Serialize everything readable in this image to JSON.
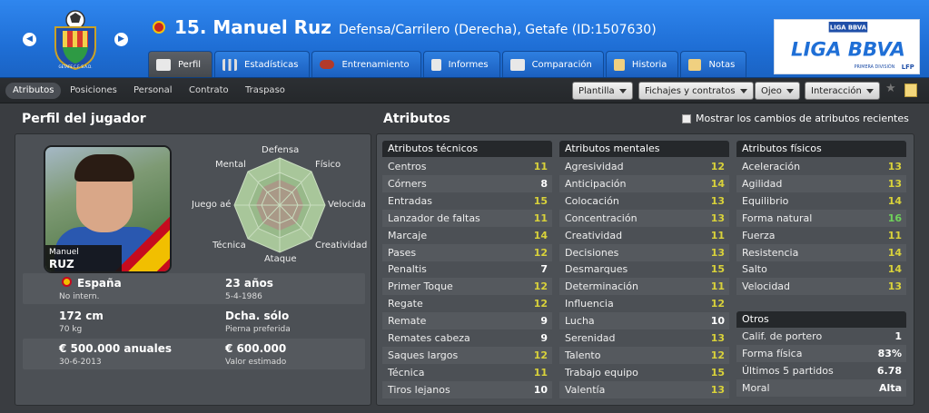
{
  "header": {
    "player_title": "15. Manuel Ruz",
    "subtitle": "Defensa/Carrilero (Derecha), Getafe (ID:1507630)",
    "nav_prev": "◀",
    "nav_next": "▶",
    "club_crest_text": "GETAFE C.F. S.A.D.",
    "league_logo_small": "LIGA BBVA",
    "league_logo_big": "LIGA BBVA",
    "league_logo_sub": "PRIMERA DIVISIÓN",
    "league_logo_tag": "LFP"
  },
  "tabs": [
    {
      "label": "Perfil",
      "active": true
    },
    {
      "label": "Estadísticas"
    },
    {
      "label": "Entrenamiento"
    },
    {
      "label": "Informes"
    },
    {
      "label": "Comparación"
    },
    {
      "label": "Historia"
    },
    {
      "label": "Notas"
    }
  ],
  "subtabs": [
    "Atributos",
    "Posiciones",
    "Personal",
    "Contrato",
    "Traspaso"
  ],
  "toolbar": {
    "plantilla": "Plantilla",
    "fichajes": "Fichajes y contratos",
    "ojeo": "Ojeo",
    "interaccion": "Interacción",
    "star": "★"
  },
  "profile": {
    "section_title": "Perfil del jugador",
    "photo_first": "Manuel",
    "photo_last": "RUZ",
    "radar_labels": {
      "defensa": "Defensa",
      "fisico": "Físico",
      "velocidad": "Velocidad",
      "creatividad": "Creatividad",
      "ataque": "Ataque",
      "tecnica": "Técnica",
      "juego_aereo": "Juego aéreo",
      "mental": "Mental"
    },
    "info": [
      {
        "a": "España",
        "b": "No intern.",
        "c": "23 años",
        "d": "5-4-1986"
      },
      {
        "a": "172 cm",
        "b": "70 kg",
        "c": "Dcha. sólo",
        "d": "Pierna preferida"
      },
      {
        "a": "€ 500.000 anuales",
        "b": "30-6-2013",
        "c": "€ 600.000",
        "d": "Valor estimado"
      }
    ]
  },
  "attributes": {
    "section_title": "Atributos",
    "show_changes_label": "Mostrar los cambios de atributos recientes",
    "tecnicos": {
      "header": "Atributos técnicos",
      "rows": [
        {
          "name": "Centros",
          "value": "11"
        },
        {
          "name": "Córners",
          "value": "8"
        },
        {
          "name": "Entradas",
          "value": "15"
        },
        {
          "name": "Lanzador de faltas",
          "value": "11"
        },
        {
          "name": "Marcaje",
          "value": "14"
        },
        {
          "name": "Pases",
          "value": "12"
        },
        {
          "name": "Penaltis",
          "value": "7"
        },
        {
          "name": "Primer Toque",
          "value": "12"
        },
        {
          "name": "Regate",
          "value": "12"
        },
        {
          "name": "Remate",
          "value": "9"
        },
        {
          "name": "Remates cabeza",
          "value": "9"
        },
        {
          "name": "Saques largos",
          "value": "12"
        },
        {
          "name": "Técnica",
          "value": "11"
        },
        {
          "name": "Tiros lejanos",
          "value": "10"
        }
      ]
    },
    "mentales": {
      "header": "Atributos mentales",
      "rows": [
        {
          "name": "Agresividad",
          "value": "12"
        },
        {
          "name": "Anticipación",
          "value": "14"
        },
        {
          "name": "Colocación",
          "value": "13"
        },
        {
          "name": "Concentración",
          "value": "13"
        },
        {
          "name": "Creatividad",
          "value": "11"
        },
        {
          "name": "Decisiones",
          "value": "13"
        },
        {
          "name": "Desmarques",
          "value": "15"
        },
        {
          "name": "Determinación",
          "value": "11"
        },
        {
          "name": "Influencia",
          "value": "12"
        },
        {
          "name": "Lucha",
          "value": "10"
        },
        {
          "name": "Serenidad",
          "value": "13"
        },
        {
          "name": "Talento",
          "value": "12"
        },
        {
          "name": "Trabajo equipo",
          "value": "15"
        },
        {
          "name": "Valentía",
          "value": "13"
        }
      ]
    },
    "fisicos": {
      "header": "Atributos físicos",
      "rows": [
        {
          "name": "Aceleración",
          "value": "13"
        },
        {
          "name": "Agilidad",
          "value": "13"
        },
        {
          "name": "Equilibrio",
          "value": "14"
        },
        {
          "name": "Forma natural",
          "value": "16"
        },
        {
          "name": "Fuerza",
          "value": "11"
        },
        {
          "name": "Resistencia",
          "value": "14"
        },
        {
          "name": "Salto",
          "value": "14"
        },
        {
          "name": "Velocidad",
          "value": "13"
        }
      ]
    },
    "otros": {
      "header": "Otros",
      "rows": [
        {
          "name": "Calif. de portero",
          "value": "1"
        },
        {
          "name": "Forma física",
          "value": "83%"
        },
        {
          "name": "Últimos 5 partidos",
          "value": "6.78"
        },
        {
          "name": "Moral",
          "value": "Alta"
        }
      ]
    }
  },
  "colors": {
    "value_yellow": "#d9d23a",
    "value_white": "#ffffff",
    "value_green": "#6fd15a",
    "header_blue": "#1f6fd6"
  }
}
